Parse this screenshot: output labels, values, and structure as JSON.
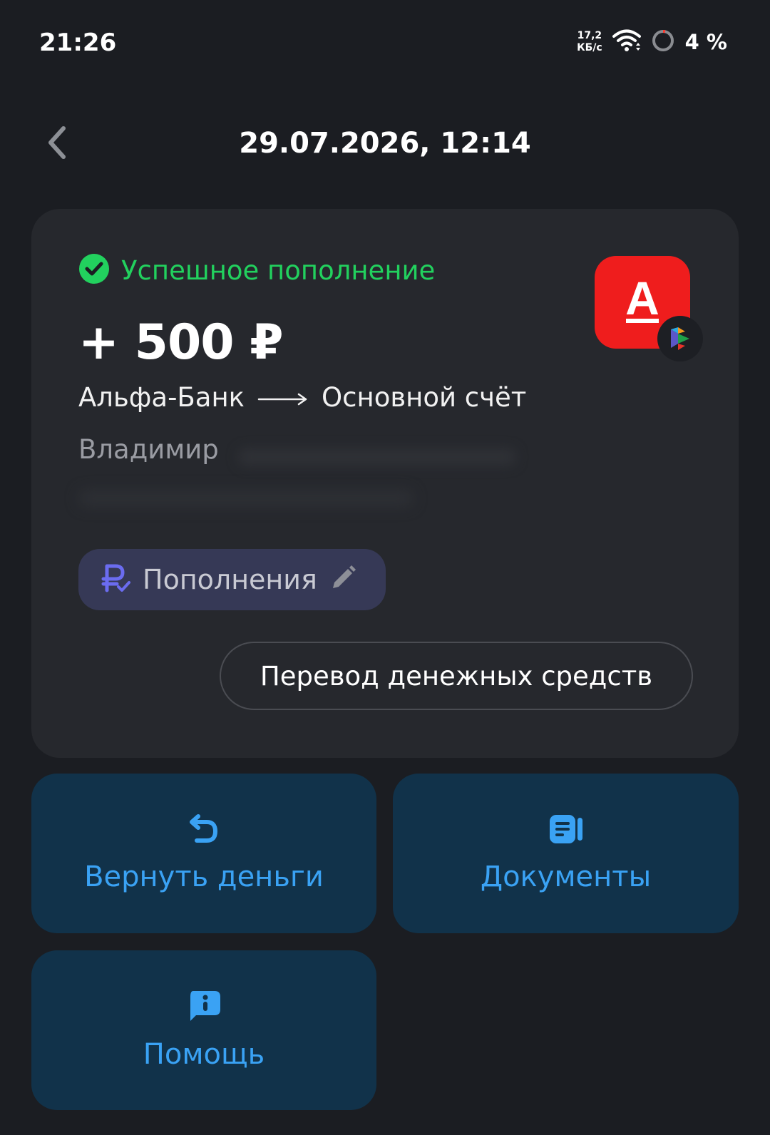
{
  "status_bar": {
    "time": "21:26",
    "speed_value": "17,2",
    "speed_unit": "КБ/с",
    "battery": "4 %"
  },
  "header": {
    "title": "29.07.2026, 12:14"
  },
  "operation": {
    "status": "Успешное пополнение",
    "amount": "+ 500 ₽",
    "from": "Альфа-Банк",
    "to": "Основной счёт",
    "sender": "Владимир",
    "category": "Пополнения",
    "type_button": "Перевод денежных средств",
    "bank_logo_letter": "А"
  },
  "actions": {
    "refund": "Вернуть деньги",
    "documents": "Документы",
    "help": "Помощь"
  },
  "colors": {
    "background": "#1b1d22",
    "card": "#26282d",
    "success": "#22d15e",
    "tile": "#11324a",
    "tile_text": "#3aa2f4",
    "bank_red": "#ef1d1d"
  },
  "icons": [
    "wifi-icon",
    "battery-icon",
    "back-icon",
    "success-check-icon",
    "arrow-right-icon",
    "ruble-check-icon",
    "pencil-icon",
    "sbp-icon",
    "refund-icon",
    "documents-icon",
    "help-icon"
  ]
}
